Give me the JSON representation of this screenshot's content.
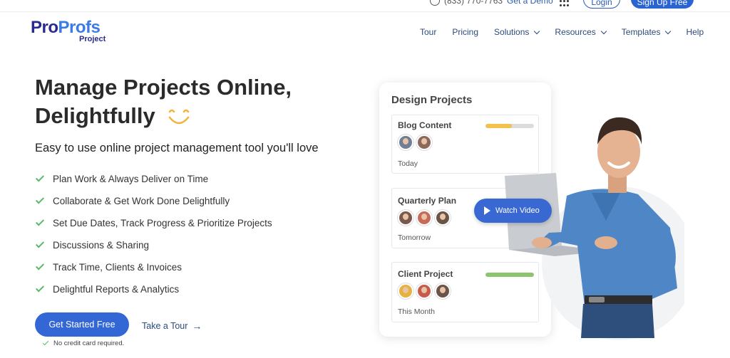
{
  "topbar": {
    "phone": "(833) 770-7763",
    "demo": "Get a Demo",
    "login": "Login",
    "signup": "Sign Up Free"
  },
  "logo": {
    "part1": "Pro",
    "part2": "Profs",
    "sub": "Project"
  },
  "nav": {
    "items": [
      {
        "label": "Tour"
      },
      {
        "label": "Pricing"
      },
      {
        "label": "Solutions"
      },
      {
        "label": "Resources"
      },
      {
        "label": "Templates"
      },
      {
        "label": "Help"
      }
    ]
  },
  "hero": {
    "title_line1": "Manage Projects Online,",
    "title_line2": "Delightfully",
    "subtitle": "Easy to use online project management tool you'll love",
    "features": [
      "Plan Work & Always Deliver on Time",
      "Collaborate & Get Work Done Delightfully",
      "Set Due Dates, Track Progress & Prioritize Projects",
      "Discussions & Sharing",
      "Track Time, Clients & Invoices",
      "Delightful Reports & Analytics"
    ],
    "cta": "Get Started Free",
    "tour": "Take a Tour",
    "no_cc": "No credit card required."
  },
  "card": {
    "title": "Design Projects",
    "tasks": [
      {
        "name": "Blog Content",
        "date": "Today",
        "progress": 0.55,
        "color": "#f2c14e"
      },
      {
        "name": "Quarterly Plan",
        "date": "Tomorrow"
      },
      {
        "name": "Client Project",
        "date": "This Month",
        "progress": 1.0,
        "color": "#8cc56b"
      }
    ]
  },
  "video": {
    "label": "Watch Video"
  },
  "colors": {
    "primary": "#3367d6",
    "check": "#58b86b",
    "nav_text": "#2b4a7d"
  }
}
